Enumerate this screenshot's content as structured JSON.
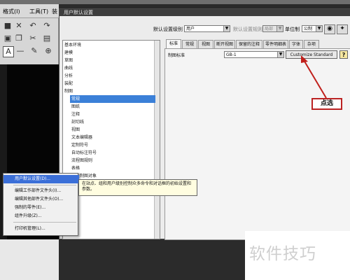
{
  "host": {
    "menubar": {
      "format": "格式(I)",
      "tools": "工具(T)",
      "more": "装"
    },
    "toolbar": {
      "close_icon": "close-icon",
      "undo_icon": "undo-icon",
      "redo_icon": "redo-icon",
      "text_icon": "text-icon"
    }
  },
  "dialog": {
    "title": "用户默认设置",
    "top_row": {
      "level_label": "默认设置级别",
      "level_value": "用户",
      "hint_label": "默认设置规则来自",
      "hint_value": "局部",
      "unit_label": "单位制",
      "unit_value": "公制"
    },
    "tree": {
      "items": [
        "基本环境",
        "建模",
        "草图",
        "曲线",
        "分析",
        "装配",
        "制图",
        "常规",
        "图纸",
        "注释",
        "剖切线",
        "视图",
        "文本编辑器",
        "定制符号",
        "自动标注符号",
        "流程图规则",
        "表格",
        "旧版制图对象"
      ],
      "selected_index": 7
    },
    "tabs": [
      "标准",
      "常规",
      "视图",
      "断开视图",
      "保留的注释",
      "零件明细表",
      "字体",
      "杂项"
    ],
    "active_tab": 0,
    "panel": {
      "std_label": "制图标准",
      "std_value": "GB-1",
      "customize_label": "Customize Standard",
      "help_label": "?"
    }
  },
  "annotation": {
    "callout": "点选"
  },
  "context_menu": {
    "items": [
      {
        "label": "用户默认设置(D)...",
        "highlight": true
      },
      {
        "label": "编辑工作部件文件头(I)...",
        "highlight": false
      },
      {
        "label": "编辑其他部件文件头(O)...",
        "highlight": false
      },
      {
        "label": "强制的零件(E)...",
        "highlight": false
      },
      {
        "label": "组件升级(Z)...",
        "highlight": false
      },
      {
        "label": "打印机管理(L)...",
        "highlight": false
      }
    ],
    "tooltip": "在站点、组和用户级别控制众多命令和对话框的初始设置和参数。"
  },
  "watermark": "软件技巧",
  "colors": {
    "selection": "#3b80d8",
    "callout_border": "#b22222",
    "menu_highlight": "#3b6fd8"
  }
}
